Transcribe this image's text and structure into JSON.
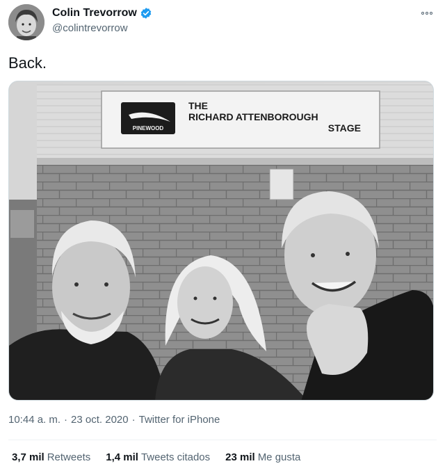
{
  "author": {
    "display_name": "Colin Trevorrow",
    "handle": "@colintrevorrow",
    "verified": true,
    "avatar": "profile-photo"
  },
  "tweet": {
    "text": "Back.",
    "media": {
      "type": "black-and-white photo",
      "sign_brand": "PINEWOOD",
      "sign_text": [
        "THE",
        "RICHARD ATTENBOROUGH",
        "STAGE"
      ]
    }
  },
  "meta": {
    "time": "10:44 a. m.",
    "date": "23 oct. 2020",
    "separator": "·",
    "source": "Twitter for iPhone"
  },
  "stats": [
    {
      "count": "3,7 mil",
      "label": "Retweets"
    },
    {
      "count": "1,4 mil",
      "label": "Tweets citados"
    },
    {
      "count": "23 mil",
      "label": "Me gusta"
    }
  ],
  "icons": {
    "verified": "verified-badge-icon",
    "more": "more-options-icon"
  },
  "colors": {
    "verified": "#1d9bf0",
    "secondary_text": "#536471",
    "text": "#0f1419"
  }
}
